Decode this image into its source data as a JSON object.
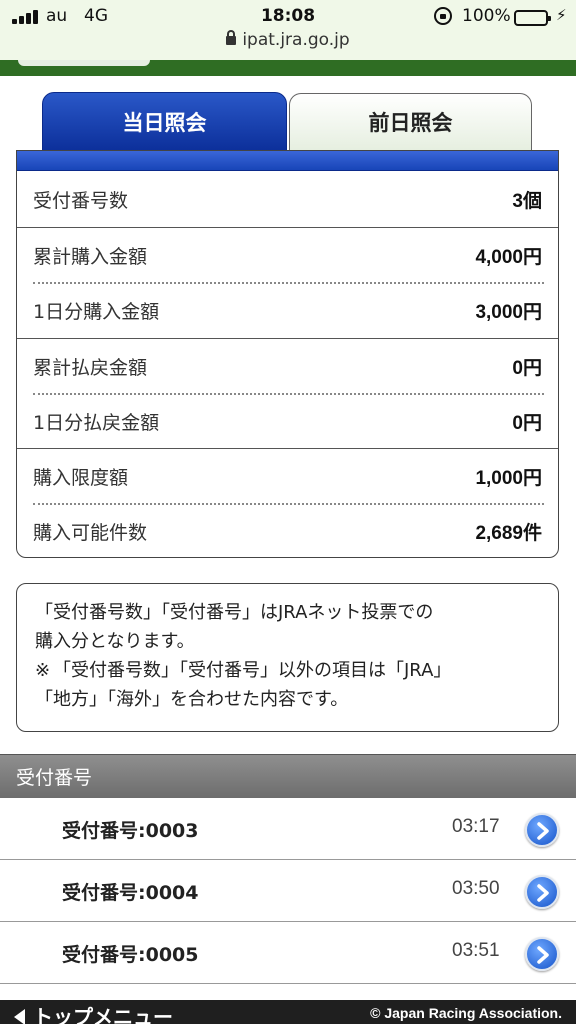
{
  "status_bar": {
    "carrier": "au",
    "network": "4G",
    "time": "18:08",
    "battery": "100%",
    "url": "ipat.jra.go.jp"
  },
  "tabs": [
    {
      "label": "当日照会",
      "active": true
    },
    {
      "label": "前日照会",
      "active": false
    }
  ],
  "summary": [
    {
      "label": "受付番号数",
      "value": "3個"
    },
    {
      "label": "累計購入金額",
      "value": "4,000円"
    },
    {
      "label": "1日分購入金額",
      "value": "3,000円"
    },
    {
      "label": "累計払戻金額",
      "value": "0円"
    },
    {
      "label": "1日分払戻金額",
      "value": "0円"
    },
    {
      "label": "購入限度額",
      "value": "1,000円"
    },
    {
      "label": "購入可能件数",
      "value": "2,689件"
    }
  ],
  "note": {
    "line1": "「受付番号数」「受付番号」はJRAネット投票での",
    "line2": "購入分となります。",
    "mark": "※",
    "line3": "「受付番号数」「受付番号」以外の項目は「JRA」",
    "line4": "「地方」「海外」を合わせた内容です。"
  },
  "receipts": {
    "header": "受付番号",
    "items": [
      {
        "label": "受付番号:0003",
        "time": "03:17"
      },
      {
        "label": "受付番号:0004",
        "time": "03:50"
      },
      {
        "label": "受付番号:0005",
        "time": "03:51"
      }
    ]
  },
  "footer": {
    "back_label": "トップメニュー",
    "copyright": "© Japan Racing Association."
  },
  "colors": {
    "accent_green": "#2f6d23",
    "tab_blue": "#0c2f9a",
    "chevron_blue": "#1553c9"
  }
}
